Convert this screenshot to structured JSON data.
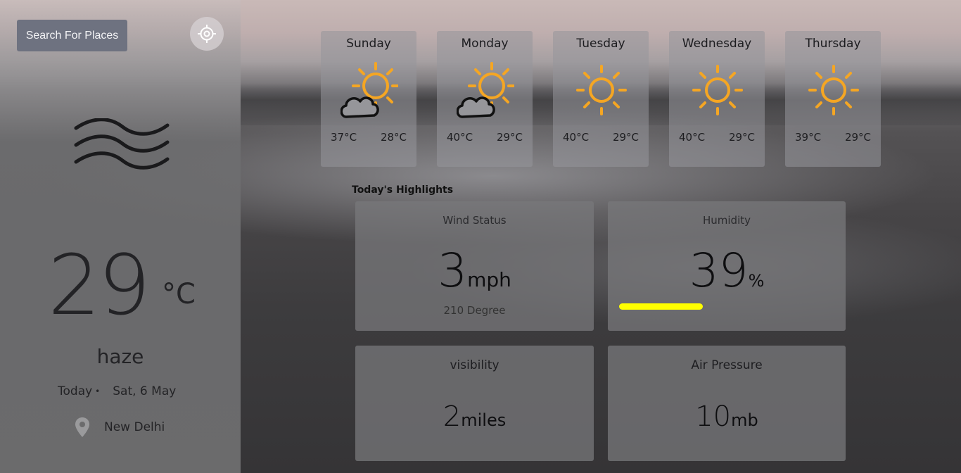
{
  "sidebar": {
    "search_label": "Search For Places",
    "temperature": "29",
    "temperature_unit": "°C",
    "condition": "haze",
    "date_prefix": "Today",
    "date_dot": "•",
    "date": "Sat, 6 May",
    "location": "New Delhi"
  },
  "forecast": [
    {
      "day": "Sunday",
      "max": "37°C",
      "min": "28°C",
      "icon": "partly-cloudy-icon"
    },
    {
      "day": "Monday",
      "max": "40°C",
      "min": "29°C",
      "icon": "partly-cloudy-icon"
    },
    {
      "day": "Tuesday",
      "max": "40°C",
      "min": "29°C",
      "icon": "sun-icon"
    },
    {
      "day": "Wednesday",
      "max": "40°C",
      "min": "29°C",
      "icon": "sun-icon"
    },
    {
      "day": "Thursday",
      "max": "39°C",
      "min": "29°C",
      "icon": "sun-icon"
    }
  ],
  "highlights": {
    "title": "Today's Highlights",
    "wind": {
      "title": "Wind Status",
      "value": "3",
      "unit": "mph",
      "direction": "210 Degree"
    },
    "humidity": {
      "title": "Humidity",
      "value": "39",
      "unit": "%",
      "bar_fraction": 0.39
    },
    "visibility": {
      "title": "visibility",
      "value": "2",
      "unit": "miles"
    },
    "pressure": {
      "title": "Air Pressure",
      "value": "10",
      "unit": "mb"
    }
  },
  "colors": {
    "sun": "#f5a623",
    "humidity_bar": "#ffff00",
    "search_button": "#6e7280"
  }
}
